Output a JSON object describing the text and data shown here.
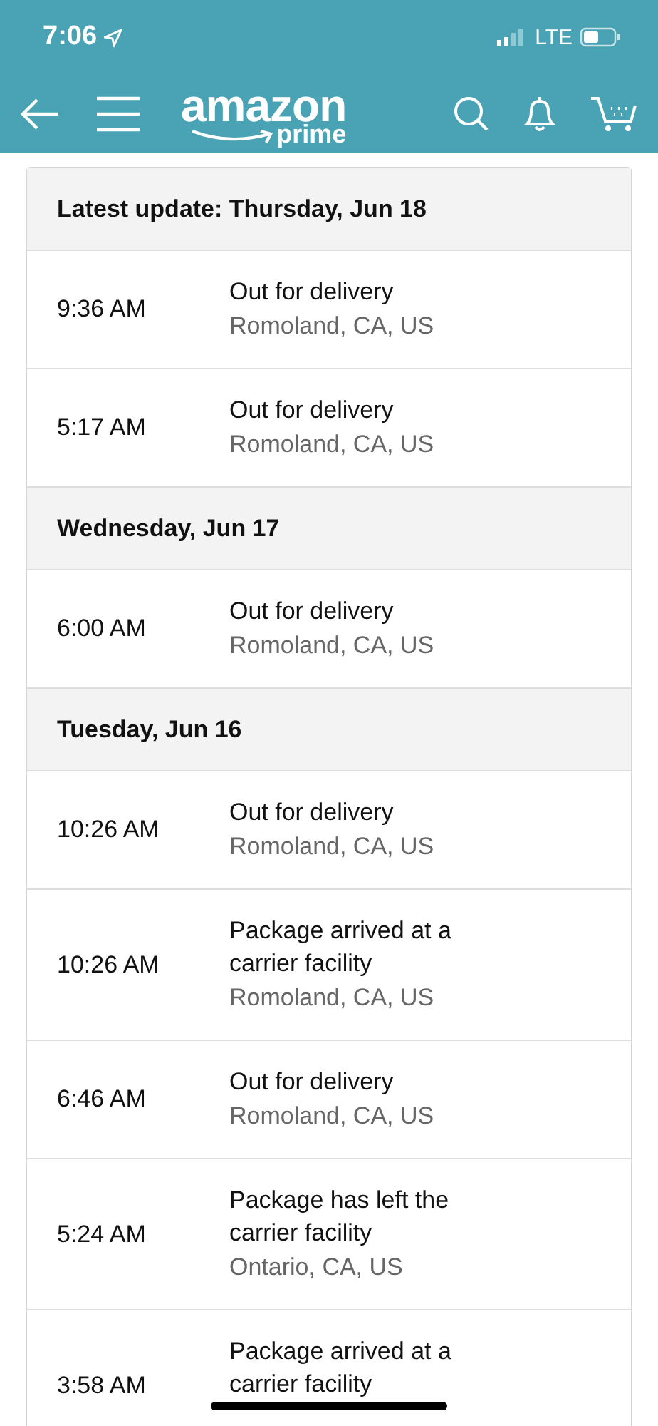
{
  "status_bar": {
    "time": "7:06",
    "network": "LTE"
  },
  "logo": {
    "wordmark": "amazon",
    "sub": "prime"
  },
  "days": [
    {
      "heading": "Latest update: Thursday, Jun 18",
      "events": [
        {
          "time": "9:36 AM",
          "status": "Out for delivery",
          "location": "Romoland, CA, US"
        },
        {
          "time": "5:17 AM",
          "status": "Out for delivery",
          "location": "Romoland, CA, US"
        }
      ]
    },
    {
      "heading": "Wednesday, Jun 17",
      "events": [
        {
          "time": "6:00 AM",
          "status": "Out for delivery",
          "location": "Romoland, CA, US"
        }
      ]
    },
    {
      "heading": "Tuesday, Jun 16",
      "events": [
        {
          "time": "10:26 AM",
          "status": "Out for delivery",
          "location": "Romoland, CA, US"
        },
        {
          "time": "10:26 AM",
          "status": "Package arrived at a carrier facility",
          "location": "Romoland, CA, US"
        },
        {
          "time": "6:46 AM",
          "status": "Out for delivery",
          "location": "Romoland, CA, US"
        },
        {
          "time": "5:24 AM",
          "status": "Package has left the carrier facility",
          "location": "Ontario, CA, US"
        },
        {
          "time": "3:58 AM",
          "status": "Package arrived at a carrier facility"
        }
      ]
    }
  ]
}
